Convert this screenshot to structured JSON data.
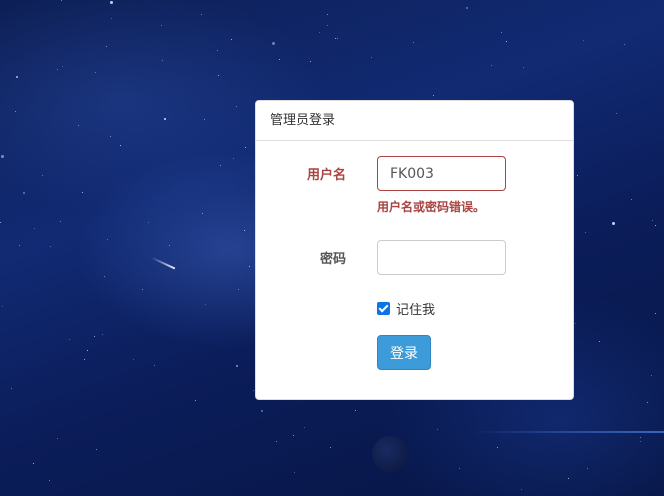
{
  "panel": {
    "title": "管理员登录"
  },
  "form": {
    "username_label": "用户名",
    "username_value": "FK003",
    "error_message": "用户名或密码错误。",
    "password_label": "密码",
    "password_value": "",
    "remember_label": "记住我",
    "remember_checked": true,
    "submit_label": "登录"
  },
  "colors": {
    "error": "#a94442",
    "primary_button": "#3c9bd8",
    "checkbox": "#0b75e5"
  }
}
